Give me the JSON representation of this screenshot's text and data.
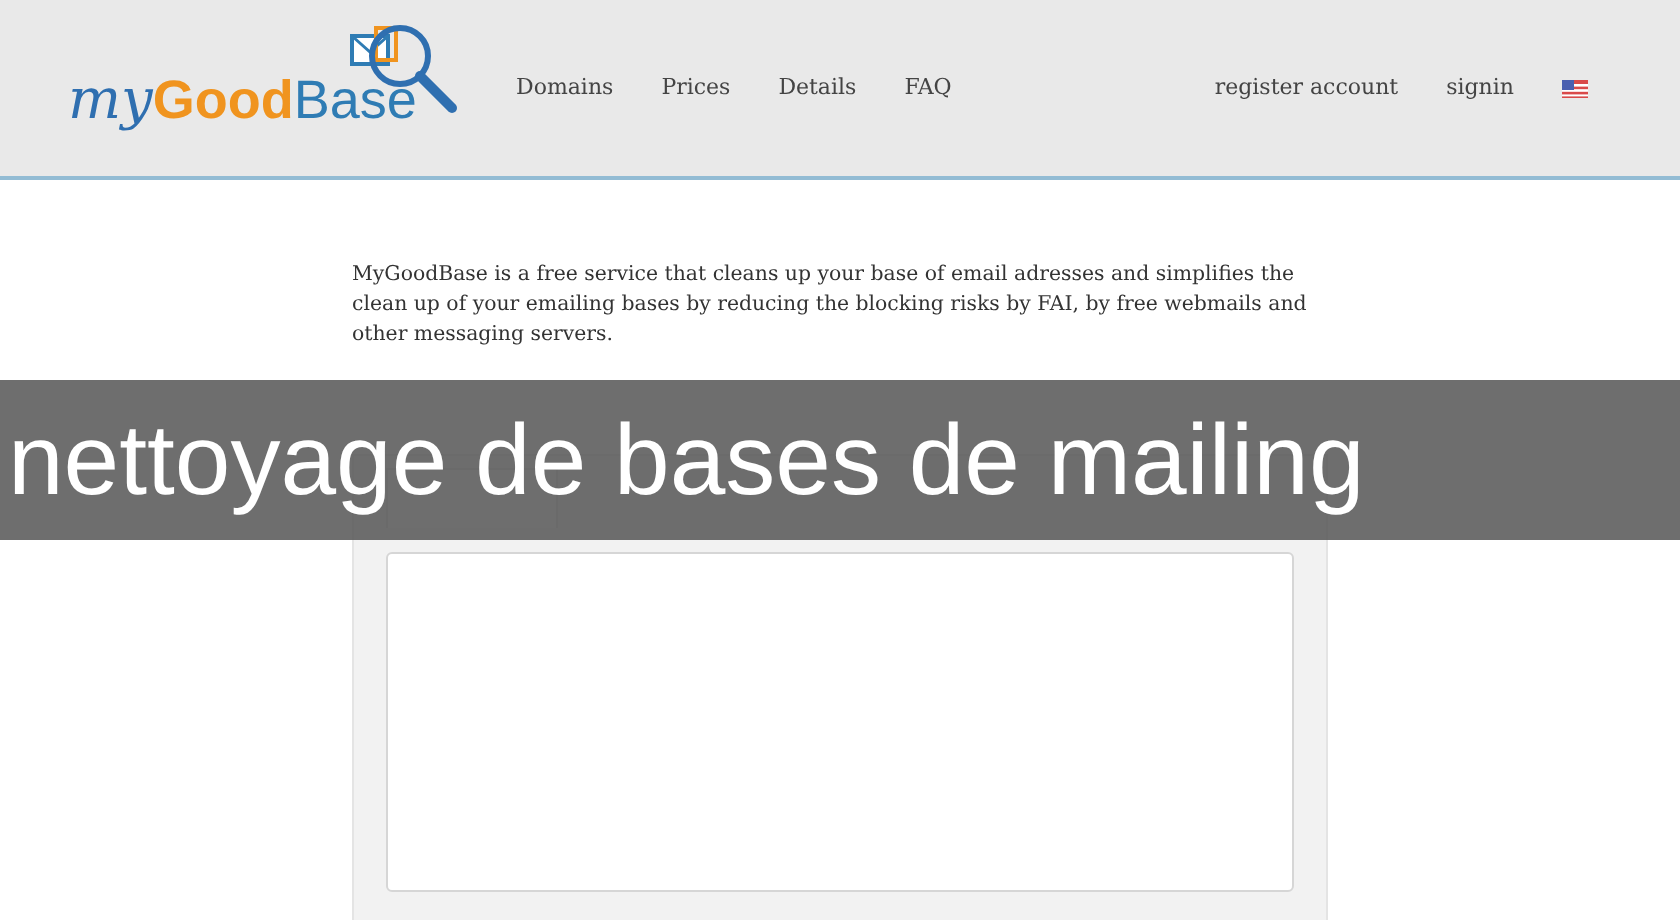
{
  "header": {
    "logo": {
      "script_part": "my",
      "bold_part": "Good",
      "plain_part": "Base"
    },
    "nav": [
      "Domains",
      "Prices",
      "Details",
      "FAQ"
    ],
    "account_links": [
      "register account",
      "signin"
    ]
  },
  "intro": "MyGoodBase is a free service that cleans up your base of email adresses and simplifies the clean up of your emailing bases by reducing the blocking risks by FAI, by free webmails and other messaging servers.",
  "overlay_caption": "nettoyage de bases de mailing"
}
